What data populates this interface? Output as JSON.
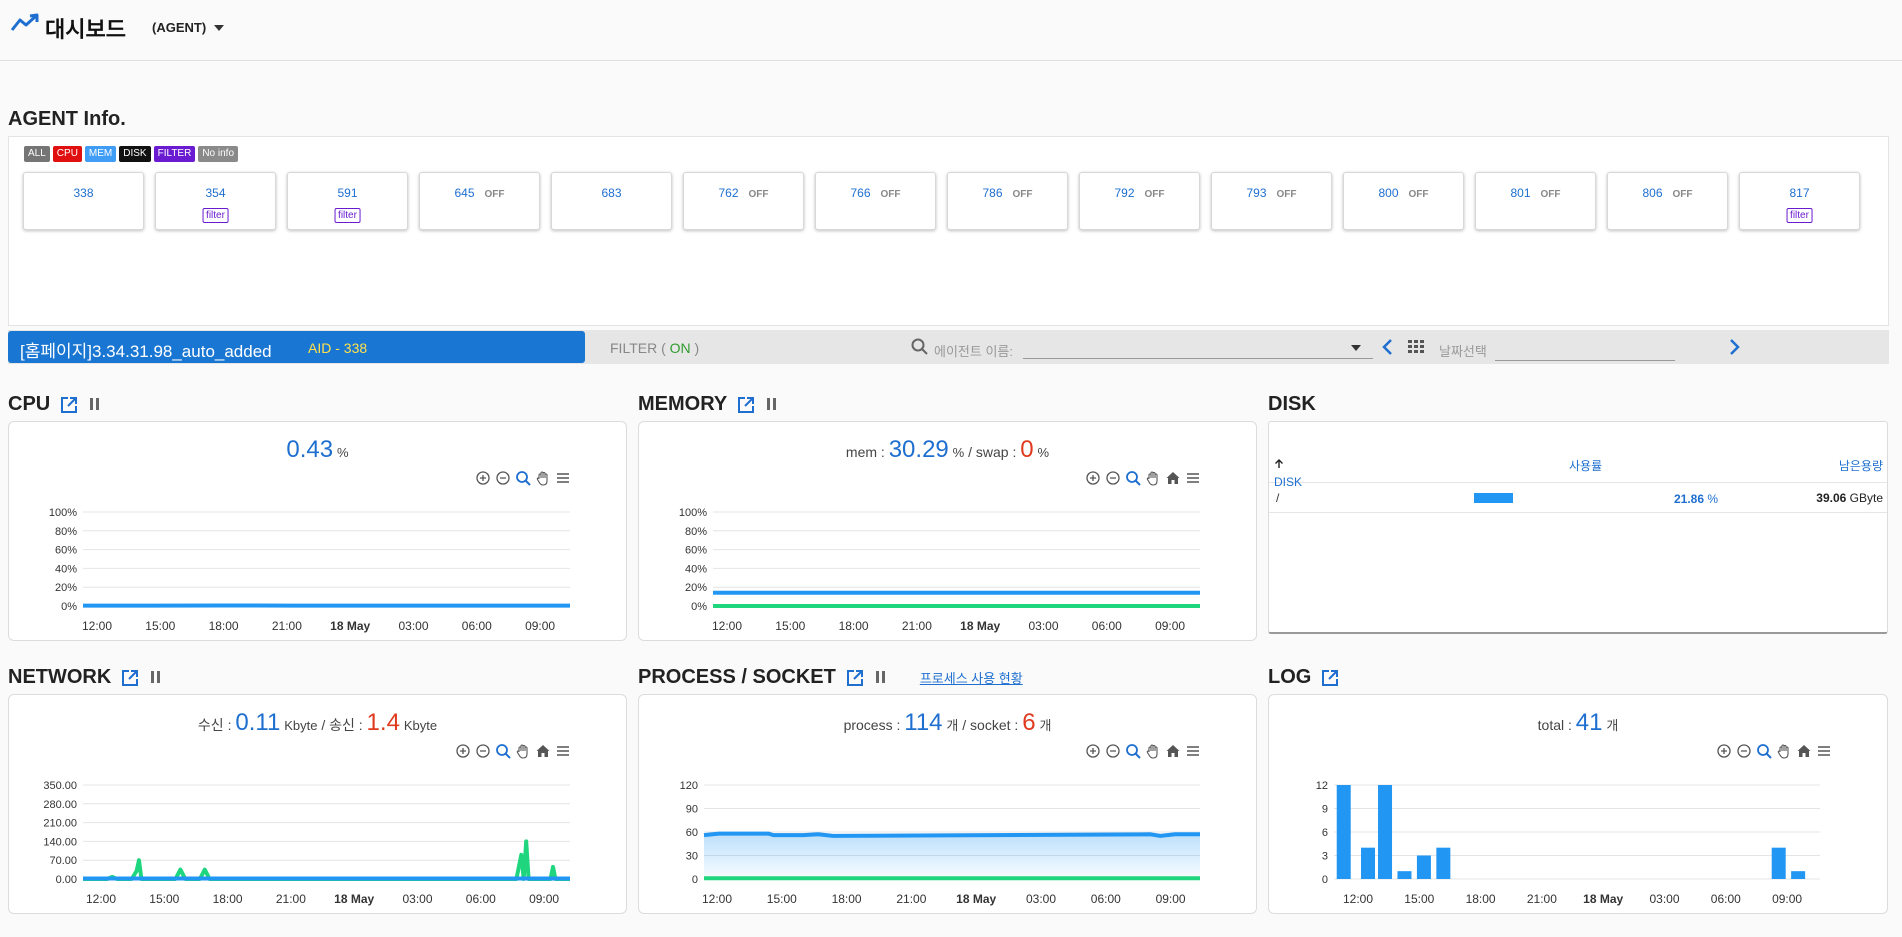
{
  "header": {
    "title": "대시보드",
    "agent_dropdown": "(AGENT)"
  },
  "agent_info": {
    "title": "AGENT Info.",
    "filters": [
      {
        "label": "ALL",
        "color": "#757575"
      },
      {
        "label": "CPU",
        "color": "#e01010"
      },
      {
        "label": "MEM",
        "color": "#3f9df5"
      },
      {
        "label": "DISK",
        "color": "#111111"
      },
      {
        "label": "FILTER",
        "color": "#6a1bd1"
      },
      {
        "label": "No info",
        "color": "#8a8a8a"
      }
    ],
    "agents": [
      {
        "id": "338",
        "off": "",
        "filter": ""
      },
      {
        "id": "354",
        "off": "",
        "filter": "filter"
      },
      {
        "id": "591",
        "off": "",
        "filter": "filter"
      },
      {
        "id": "645",
        "off": "OFF",
        "filter": ""
      },
      {
        "id": "683",
        "off": "",
        "filter": ""
      },
      {
        "id": "762",
        "off": "OFF",
        "filter": ""
      },
      {
        "id": "766",
        "off": "OFF",
        "filter": ""
      },
      {
        "id": "786",
        "off": "OFF",
        "filter": ""
      },
      {
        "id": "792",
        "off": "OFF",
        "filter": ""
      },
      {
        "id": "793",
        "off": "OFF",
        "filter": ""
      },
      {
        "id": "800",
        "off": "OFF",
        "filter": ""
      },
      {
        "id": "801",
        "off": "OFF",
        "filter": ""
      },
      {
        "id": "806",
        "off": "OFF",
        "filter": ""
      },
      {
        "id": "817",
        "off": "",
        "filter": "filter"
      }
    ]
  },
  "toolbar": {
    "agent_name": "[홈페이지]3.34.31.98_auto_added",
    "aid": "AID - 338",
    "filter_prefix": "FILTER ( ",
    "filter_state": "ON",
    "filter_suffix": " )",
    "search_placeholder": "에이전트 이름:",
    "date_placeholder": "날짜선택"
  },
  "cpu": {
    "title": "CPU",
    "value": "0.43",
    "unit": "%"
  },
  "memory": {
    "title": "MEMORY",
    "mem_label": "mem : ",
    "mem_value": "30.29",
    "mem_unit": "%",
    "swap_label": " / swap : ",
    "swap_value": "0",
    "swap_unit": "%"
  },
  "disk": {
    "title": "DISK",
    "col_disk": "DISK",
    "col_usage": "사용률",
    "col_free": "남은용량",
    "rows": [
      {
        "mount": "/",
        "usage_value": "21.86",
        "usage_unit": "%",
        "usage_fraction": 0.2186,
        "free_value": "39.06",
        "free_unit": "GByte"
      }
    ]
  },
  "network": {
    "title": "NETWORK",
    "rx_label": "수신 : ",
    "rx_value": "0.11",
    "rx_unit": "Kbyte",
    "tx_label": " / 송신 : ",
    "tx_value": "1.4",
    "tx_unit": "Kbyte"
  },
  "process": {
    "title": "PROCESS / SOCKET",
    "link": "프로세스 사용 현황",
    "proc_label": "process : ",
    "proc_value": "114",
    "proc_unit": "개",
    "sock_label": " / socket : ",
    "sock_value": "6",
    "sock_unit": "개"
  },
  "log": {
    "title": "LOG",
    "total_label": "total : ",
    "total_value": "41",
    "total_unit": "개"
  },
  "chart_data": [
    {
      "type": "line",
      "id": "cpu",
      "x": [
        "12:00",
        "15:00",
        "18:00",
        "21:00",
        "18 May",
        "03:00",
        "06:00",
        "09:00"
      ],
      "ytick_labels": [
        "0%",
        "20%",
        "40%",
        "60%",
        "80%",
        "100%"
      ],
      "ylim": [
        0,
        100
      ],
      "series": [
        {
          "values": [
            0.4,
            0.4,
            0.5,
            0.4,
            0.4,
            0.4,
            0.4,
            0.4
          ],
          "color": "#2196f3"
        }
      ]
    },
    {
      "type": "line",
      "id": "memory",
      "x": [
        "12:00",
        "15:00",
        "18:00",
        "21:00",
        "18 May",
        "03:00",
        "06:00",
        "09:00"
      ],
      "ytick_labels": [
        "0%",
        "20%",
        "40%",
        "60%",
        "80%",
        "100%"
      ],
      "ylim": [
        0,
        100
      ],
      "series": [
        {
          "values": [
            14,
            14,
            14,
            14,
            14,
            14,
            14,
            14
          ],
          "color": "#2196f3"
        },
        {
          "values": [
            0,
            0,
            0,
            0,
            0,
            0,
            0,
            0
          ],
          "color": "#1fd67f"
        }
      ]
    },
    {
      "type": "line",
      "id": "network",
      "x": [
        "12:00",
        "15:00",
        "18:00",
        "21:00",
        "18 May",
        "03:00",
        "06:00",
        "09:00"
      ],
      "ytick_labels": [
        "0.00",
        "70.00",
        "140.00",
        "210.00",
        "280.00",
        "350.00"
      ],
      "ylim": [
        0,
        350
      ],
      "series": [
        {
          "points": [
            [
              0,
              0
            ],
            [
              0.05,
              0
            ],
            [
              0.06,
              8
            ],
            [
              0.07,
              0
            ],
            [
              0.1,
              0
            ],
            [
              0.11,
              30
            ],
            [
              0.115,
              70
            ],
            [
              0.12,
              0
            ],
            [
              0.19,
              0
            ],
            [
              0.2,
              35
            ],
            [
              0.21,
              0
            ],
            [
              0.24,
              0
            ],
            [
              0.25,
              35
            ],
            [
              0.26,
              0
            ],
            [
              0.89,
              0
            ],
            [
              0.9,
              90
            ],
            [
              0.905,
              0
            ],
            [
              0.91,
              140
            ],
            [
              0.915,
              0
            ],
            [
              0.96,
              0
            ],
            [
              0.965,
              45
            ],
            [
              0.97,
              0
            ],
            [
              1,
              0
            ]
          ],
          "color": "#1fd67f"
        },
        {
          "points": [
            [
              0,
              2
            ],
            [
              1,
              2
            ]
          ],
          "color": "#2196f3"
        }
      ]
    },
    {
      "type": "area",
      "id": "process",
      "x": [
        "12:00",
        "15:00",
        "18:00",
        "21:00",
        "18 May",
        "03:00",
        "06:00",
        "09:00"
      ],
      "ytick_labels": [
        "0",
        "30",
        "60",
        "90",
        "120"
      ],
      "ylim": [
        0,
        120
      ],
      "series": [
        {
          "points": [
            [
              0,
              56
            ],
            [
              0.03,
              58
            ],
            [
              0.13,
              58
            ],
            [
              0.14,
              56
            ],
            [
              0.2,
              56
            ],
            [
              0.23,
              57
            ],
            [
              0.26,
              55
            ],
            [
              0.9,
              57
            ],
            [
              0.92,
              55
            ],
            [
              0.95,
              57
            ],
            [
              1,
              57
            ]
          ],
          "color": "#2196f3"
        },
        {
          "points": [
            [
              0,
              1
            ],
            [
              1,
              1
            ]
          ],
          "color": "#1fd67f"
        }
      ]
    },
    {
      "type": "bar",
      "id": "log",
      "x": [
        "12:00",
        "15:00",
        "18:00",
        "21:00",
        "18 May",
        "03:00",
        "06:00",
        "09:00"
      ],
      "ytick_labels": [
        "0",
        "3",
        "6",
        "9",
        "12"
      ],
      "ylim": [
        0,
        12
      ],
      "bars": [
        {
          "t": 0.02,
          "v": 12
        },
        {
          "t": 0.07,
          "v": 4
        },
        {
          "t": 0.105,
          "v": 12
        },
        {
          "t": 0.145,
          "v": 1
        },
        {
          "t": 0.185,
          "v": 3
        },
        {
          "t": 0.225,
          "v": 4
        },
        {
          "t": 0.915,
          "v": 4
        },
        {
          "t": 0.955,
          "v": 1
        }
      ],
      "color": "#2196f3"
    }
  ]
}
